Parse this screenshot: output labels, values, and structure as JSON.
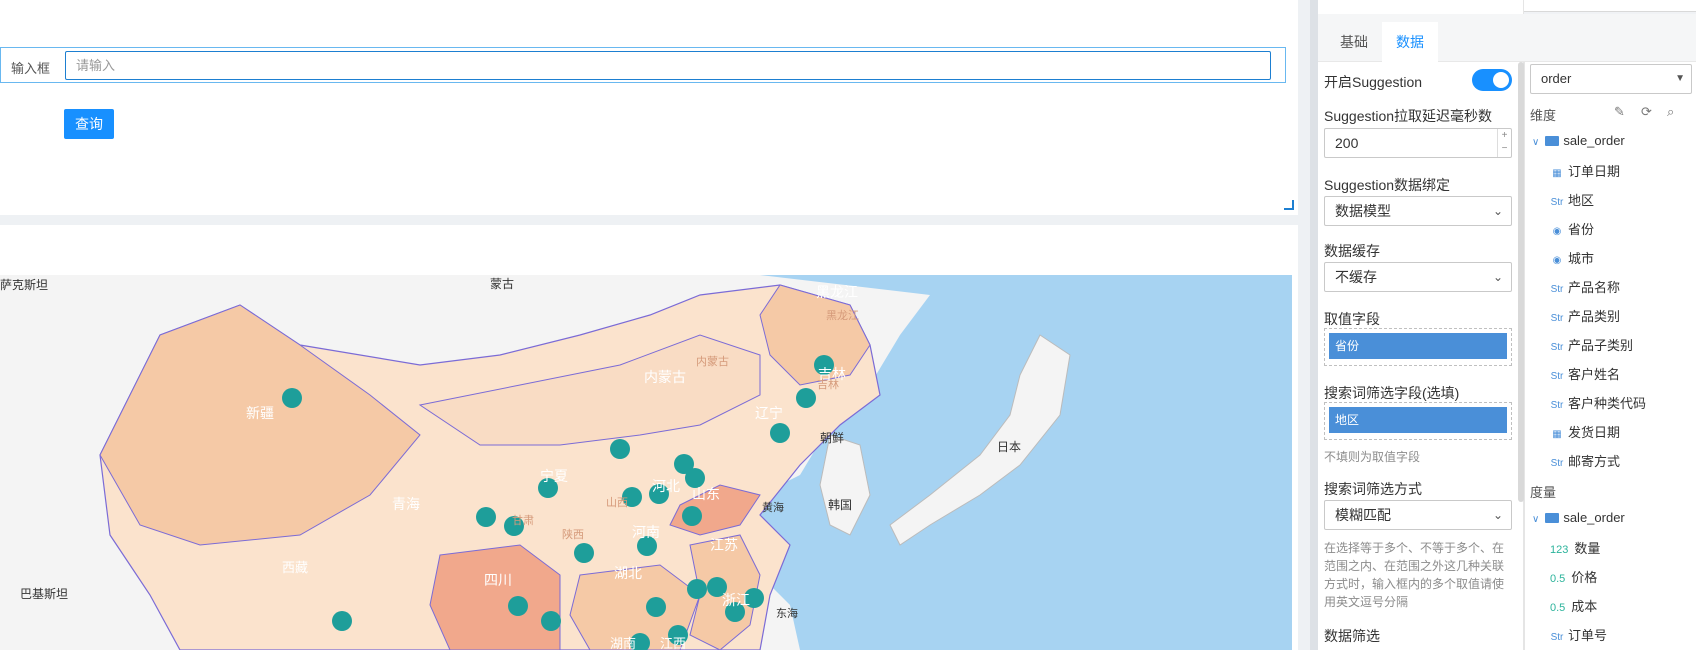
{
  "query": {
    "label": "输入框",
    "placeholder": "请输入",
    "button": "查询"
  },
  "map": {
    "labels": [
      "萨克斯坦",
      "蒙古",
      "黑龙江",
      "黑龙江",
      "内蒙古",
      "内蒙古",
      "吉林",
      "辽宁",
      "朝鲜",
      "日本",
      "韩国",
      "新疆",
      "青海",
      "甘肃",
      "宁夏",
      "山西",
      "河北",
      "山东",
      "河南",
      "陕西",
      "江苏",
      "湖北",
      "四川",
      "西藏",
      "巴基斯坦",
      "黄海",
      "东海",
      "浙江",
      "湖南",
      "江西",
      "吉林"
    ],
    "colors": {
      "ocean": "#a7d3f2",
      "land_base": "#f7e6d8",
      "province_light": "#fbe3cd",
      "province_mid": "#f5c9a6",
      "province_dark": "#f1a88c",
      "marker": "#1e9e9a",
      "border": "#7b6bd6"
    }
  },
  "panel": {
    "tabs": [
      "基础",
      "数据"
    ],
    "active_tab": "数据",
    "suggestion_toggle_label": "开启Suggestion",
    "suggestion_toggle": true,
    "delay_label": "Suggestion拉取延迟毫秒数",
    "delay_value": "200",
    "binding_label": "Suggestion数据绑定",
    "binding_value": "数据模型",
    "cache_label": "数据缓存",
    "cache_value": "不缓存",
    "value_field_label": "取值字段",
    "value_field_chip": "省份",
    "filter_field_label": "搜索词筛选字段(选填)",
    "filter_field_chip": "地区",
    "filter_field_hint": "不填则为取值字段",
    "filter_mode_label": "搜索词筛选方式",
    "filter_mode_value": "模糊匹配",
    "filter_mode_hint": "在选择等于多个、不等于多个、在范围之内、在范围之外这几种关联方式时，输入框内的多个取值请使用英文逗号分隔",
    "data_filter_label": "数据筛选"
  },
  "data_model": {
    "selected": "order",
    "dimensions_label": "维度",
    "measures_label": "度量",
    "dimension_table": "sale_order",
    "dimensions": [
      {
        "type": "date",
        "label": "订单日期"
      },
      {
        "type": "Str",
        "label": "地区"
      },
      {
        "type": "geo",
        "label": "省份"
      },
      {
        "type": "geo",
        "label": "城市"
      },
      {
        "type": "Str",
        "label": "产品名称"
      },
      {
        "type": "Str",
        "label": "产品类别"
      },
      {
        "type": "Str",
        "label": "产品子类别"
      },
      {
        "type": "Str",
        "label": "客户姓名"
      },
      {
        "type": "Str",
        "label": "客户种类代码"
      },
      {
        "type": "date",
        "label": "发货日期"
      },
      {
        "type": "Str",
        "label": "邮寄方式"
      }
    ],
    "measure_table": "sale_order",
    "measures": [
      {
        "type": "123",
        "label": "数量"
      },
      {
        "type": "0.5",
        "label": "价格"
      },
      {
        "type": "0.5",
        "label": "成本"
      },
      {
        "type": "Str",
        "label": "订单号"
      }
    ]
  }
}
